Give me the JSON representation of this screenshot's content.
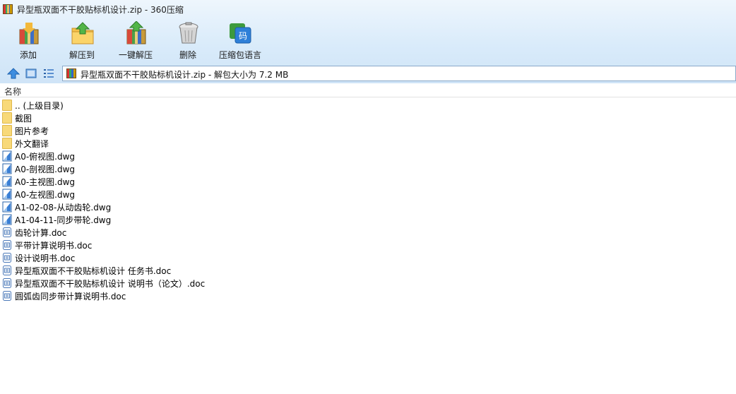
{
  "window": {
    "title": "异型瓶双面不干胶贴标机设计.zip - 360压缩"
  },
  "toolbar": {
    "buttons": [
      {
        "label": "添加",
        "icon": "add-archive-icon"
      },
      {
        "label": "解压到",
        "icon": "extract-to-icon"
      },
      {
        "label": "一键解压",
        "icon": "one-click-extract-icon"
      },
      {
        "label": "删除",
        "icon": "delete-bin-icon"
      },
      {
        "label": "压缩包语言",
        "icon": "archive-language-icon"
      }
    ],
    "language_glyph": "码"
  },
  "address": {
    "archive": "异型瓶双面不干胶贴标机设计.zip",
    "info": " - 解包大小为 7.2 MB"
  },
  "list": {
    "column_name": "名称",
    "items": [
      {
        "name": ".. (上级目录)",
        "type": "folder"
      },
      {
        "name": "截图",
        "type": "folder"
      },
      {
        "name": "图片参考",
        "type": "folder"
      },
      {
        "name": "外文翻译",
        "type": "folder"
      },
      {
        "name": "A0-俯视图.dwg",
        "type": "dwg"
      },
      {
        "name": "A0-剖视图.dwg",
        "type": "dwg"
      },
      {
        "name": "A0-主视图.dwg",
        "type": "dwg"
      },
      {
        "name": "A0-左视图.dwg",
        "type": "dwg"
      },
      {
        "name": "A1-02-08-从动齿轮.dwg",
        "type": "dwg"
      },
      {
        "name": "A1-04-11-同步带轮.dwg",
        "type": "dwg"
      },
      {
        "name": "齿轮计算.doc",
        "type": "doc"
      },
      {
        "name": "平带计算说明书.doc",
        "type": "doc"
      },
      {
        "name": "设计说明书.doc",
        "type": "doc"
      },
      {
        "name": "异型瓶双面不干胶贴标机设计 任务书.doc",
        "type": "doc"
      },
      {
        "name": "异型瓶双面不干胶贴标机设计 说明书（论文）.doc",
        "type": "doc"
      },
      {
        "name": "圆弧齿同步带计算说明书.doc",
        "type": "doc"
      }
    ]
  }
}
